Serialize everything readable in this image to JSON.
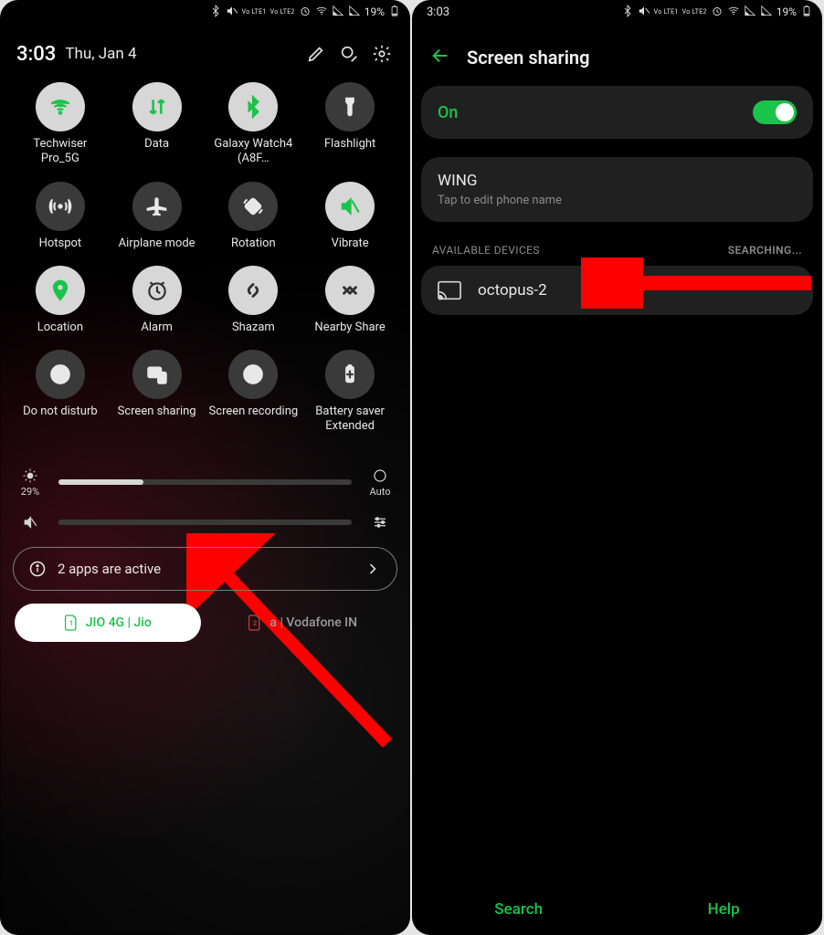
{
  "status": {
    "time": "3:03",
    "lte1": "Vo LTE1",
    "lte2": "Vo LTE2",
    "battery_pct": "19%"
  },
  "qs_header": {
    "time": "3:03",
    "date": "Thu, Jan 4"
  },
  "tiles": [
    {
      "label": "Techwiser Pro_5G"
    },
    {
      "label": "Data"
    },
    {
      "label": "Galaxy Watch4 (A8F…"
    },
    {
      "label": "Flashlight"
    },
    {
      "label": "Hotspot"
    },
    {
      "label": "Airplane mode"
    },
    {
      "label": "Rotation"
    },
    {
      "label": "Vibrate"
    },
    {
      "label": "Location"
    },
    {
      "label": "Alarm"
    },
    {
      "label": "Shazam"
    },
    {
      "label": "Nearby Share"
    },
    {
      "label": "Do not disturb"
    },
    {
      "label": "Screen sharing"
    },
    {
      "label": "Screen recording"
    },
    {
      "label": "Battery saver Extended"
    }
  ],
  "brightness": {
    "percent_label": "29%",
    "fill_pct": 29,
    "auto_label": "Auto"
  },
  "active_apps": {
    "text": "2 apps are active"
  },
  "sims": {
    "sim1": "JIO 4G | Jio",
    "sim2": "a | Vodafone IN",
    "sim2_badge": "2"
  },
  "screen_sharing": {
    "title": "Screen sharing",
    "on_label": "On",
    "phone_name": "WING",
    "phone_hint": "Tap to edit phone name",
    "section": "AVAILABLE DEVICES",
    "searching": "SEARCHING...",
    "device": "octopus-2",
    "search_btn": "Search",
    "help_btn": "Help"
  }
}
